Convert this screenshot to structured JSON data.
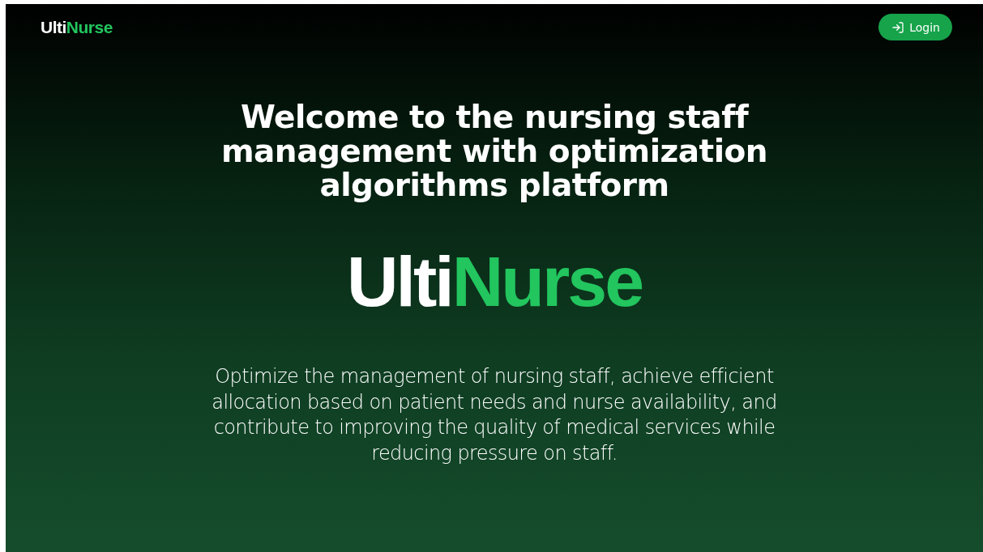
{
  "header": {
    "logo": {
      "light": "Ulti",
      "accent": "Nurse"
    },
    "login_button": "Login"
  },
  "hero": {
    "title": "Welcome to the nursing staff management with optimization algorithms platform",
    "logo": {
      "light": "Ulti",
      "accent": "Nurse"
    },
    "description": "Optimize the management of nursing staff, achieve efficient allocation based on patient needs and nurse availability, and contribute to improving the quality of medical services while reducing pressure on staff."
  }
}
